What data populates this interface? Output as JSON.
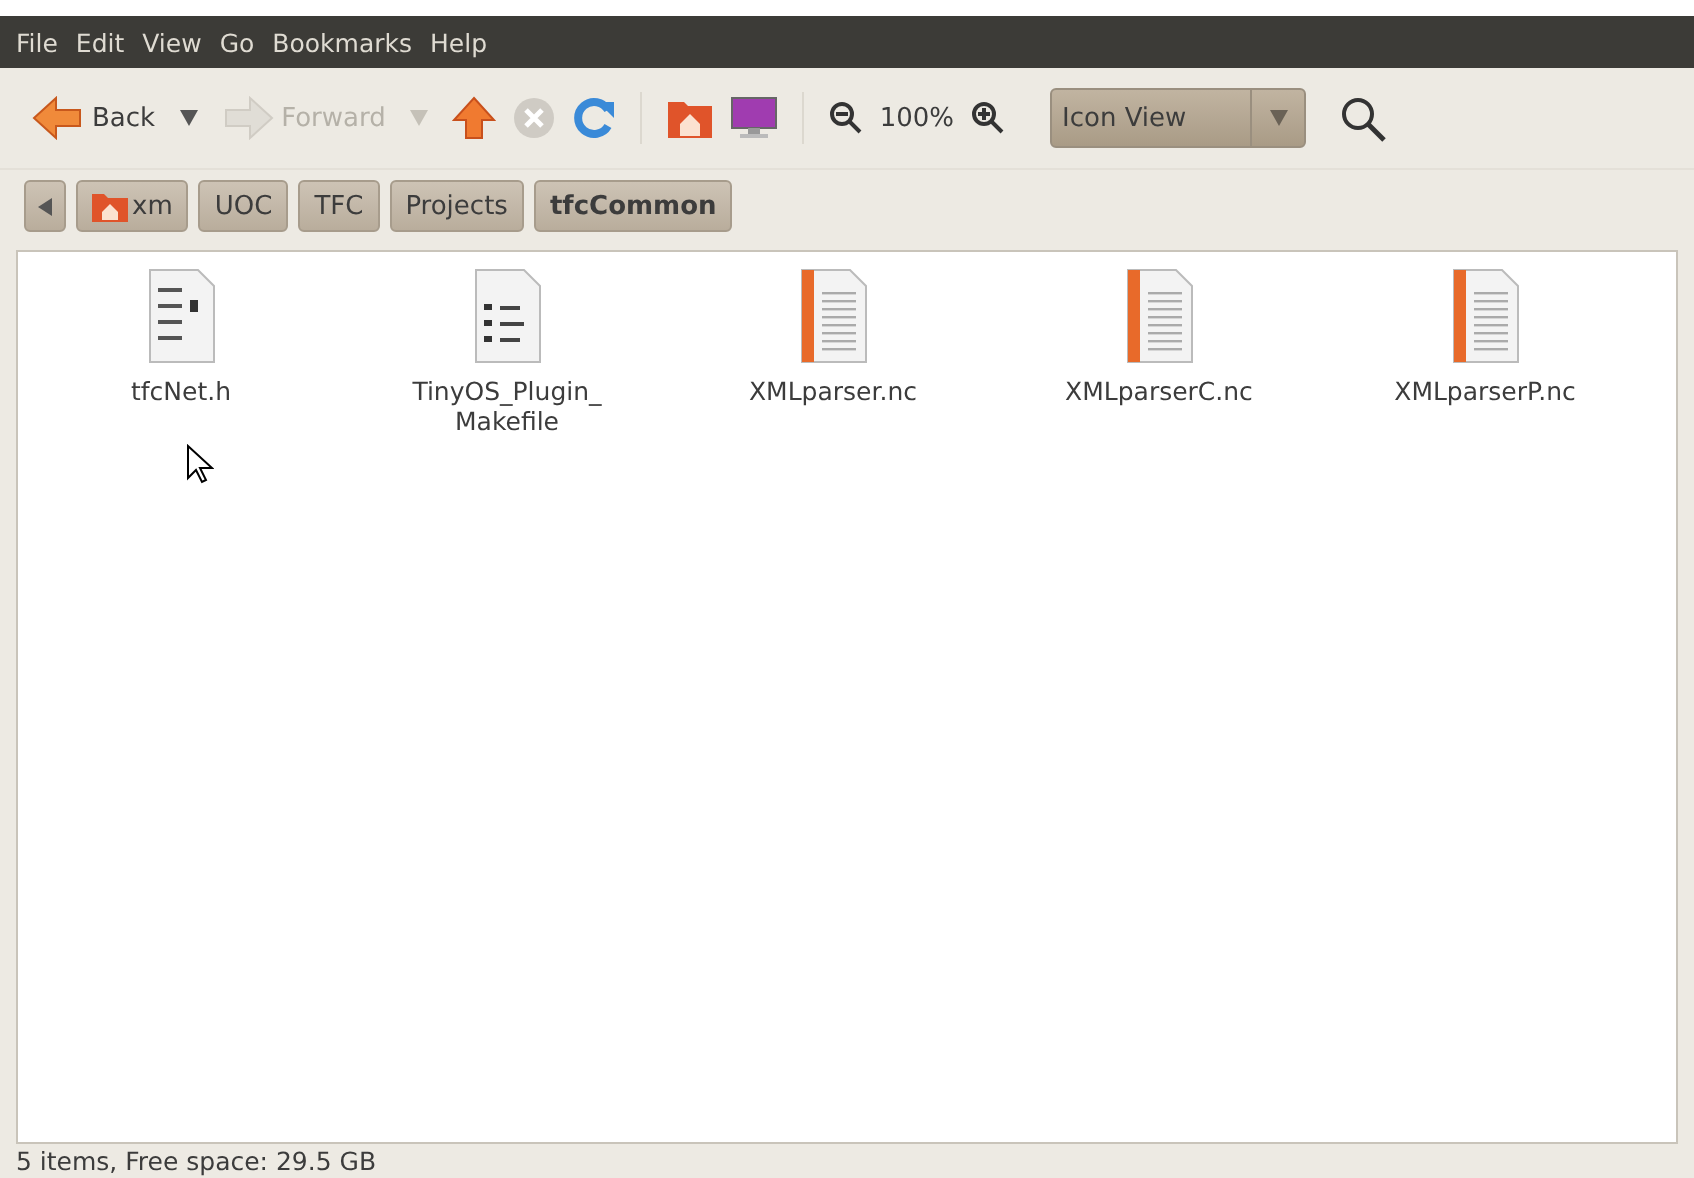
{
  "menubar": [
    "File",
    "Edit",
    "View",
    "Go",
    "Bookmarks",
    "Help"
  ],
  "toolbar": {
    "back": {
      "label": "Back",
      "disabled": false
    },
    "forward": {
      "label": "Forward",
      "disabled": true
    },
    "stop_disabled": true,
    "zoom": "100%",
    "view_select": "Icon View"
  },
  "pathbar": [
    {
      "label": "xm",
      "home": true,
      "selected": false
    },
    {
      "label": "UOC",
      "home": false,
      "selected": false
    },
    {
      "label": "TFC",
      "home": false,
      "selected": false
    },
    {
      "label": "Projects",
      "home": false,
      "selected": false
    },
    {
      "label": "tfcCommon",
      "home": false,
      "selected": true
    }
  ],
  "files": [
    {
      "name": "tfcNet.h",
      "kind": "header"
    },
    {
      "name": "TinyOS_Plugin_\nMakefile",
      "kind": "makefile"
    },
    {
      "name": "XMLparser.nc",
      "kind": "source"
    },
    {
      "name": "XMLparserC.nc",
      "kind": "source"
    },
    {
      "name": "XMLparserP.nc",
      "kind": "source"
    }
  ],
  "status_bar": "5 items, Free space: 29.5 GB"
}
